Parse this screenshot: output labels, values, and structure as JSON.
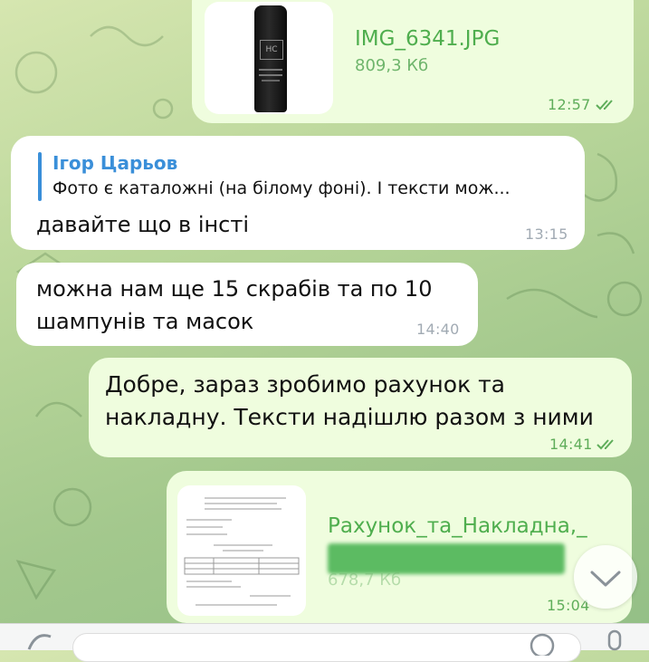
{
  "messages": {
    "photo": {
      "file_name": "IMG_6341.JPG",
      "file_size": "809,3 Кб",
      "time": "12:57"
    },
    "reply": {
      "quoted_author": "Ігор Царьов",
      "quoted_text": "Фото є каталожні (на білому фоні). І тексти мож...",
      "text": "давайте що в інсті",
      "time": "13:15"
    },
    "incoming2": {
      "line1": "можна нам ще 15 скрабів та по 10",
      "line2": "шампунів та масок",
      "time": "14:40"
    },
    "outgoing": {
      "line1": "Добре, зараз зробимо рахунок та",
      "line2": "накладну. Тексти надішлю разом з ними",
      "time": "14:41"
    },
    "document": {
      "file_name": "Рахунок_та_Накладна,_",
      "file_size": "678,7 Кб",
      "time": "15:04"
    }
  },
  "colors": {
    "outgoing_bubble": "#effdde",
    "incoming_bubble": "#ffffff",
    "reply_accent": "#3a8fd9",
    "file_green": "#4fae4e"
  },
  "icons": [
    "double-check-icon",
    "chevron-down-icon",
    "attach-icon",
    "mic-icon",
    "sticker-icon"
  ]
}
